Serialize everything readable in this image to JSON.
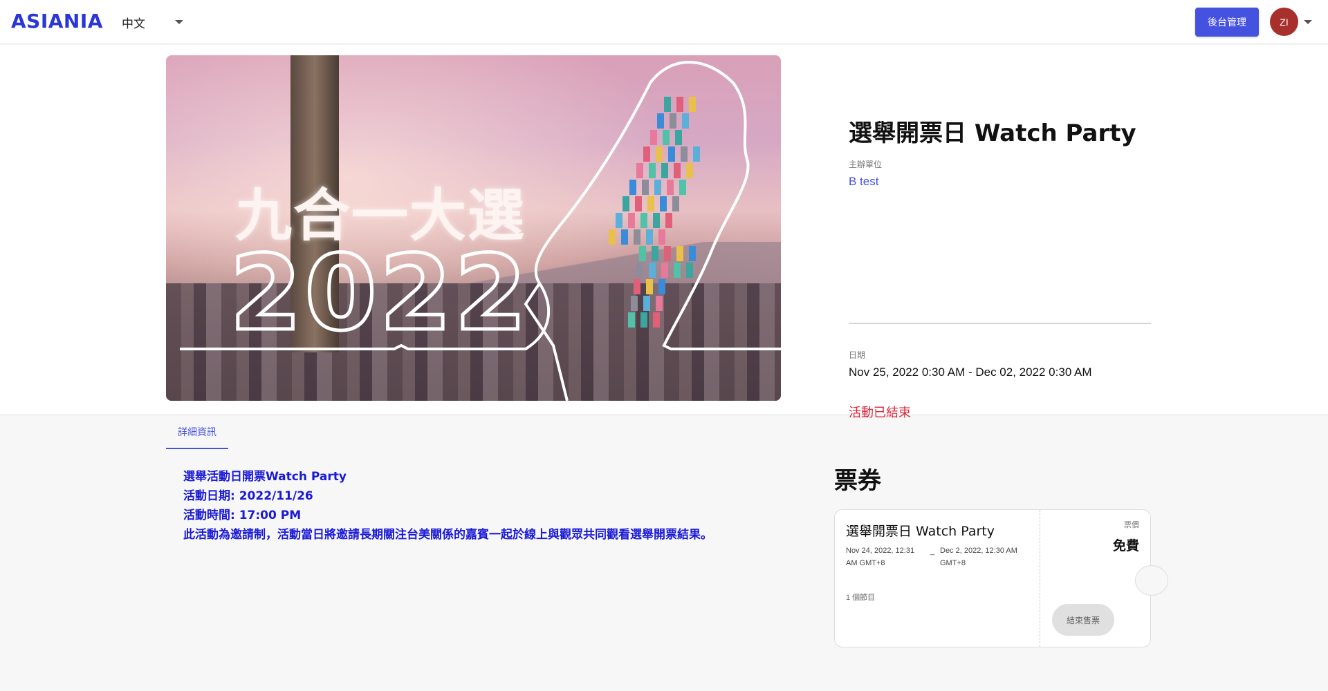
{
  "header": {
    "logo": "ASIANIA",
    "language": "中文",
    "admin_button": "後台管理",
    "avatar_initials": "ZI"
  },
  "banner": {
    "headline": "九合一大選",
    "year": "2022"
  },
  "event": {
    "title": "選舉開票日 Watch Party",
    "organizer_label": "主辦單位",
    "organizer_name": "B test",
    "date_label": "日期",
    "date_value": "Nov 25, 2022 0:30 AM - Dec 02, 2022 0:30 AM",
    "status": "活動已結束"
  },
  "tabs": [
    {
      "label": "詳細資訊",
      "active": true
    }
  ],
  "description": {
    "lines": [
      "選舉活動日開票Watch Party",
      "活動日期: 2022/11/26",
      "活動時間: 17:00 PM",
      "此活動為邀請制，活動當日將邀請長期關注台美關係的嘉賓一起於線上與觀眾共同觀看選舉開票結果。"
    ]
  },
  "tickets": {
    "heading": "票券",
    "items": [
      {
        "name": "選舉開票日 Watch Party",
        "start": "Nov 24, 2022, 12:31 AM GMT+8",
        "separator": "_",
        "end": "Dec 2, 2022, 12:30 AM GMT+8",
        "items_count": "1 個節目",
        "price_label": "票價",
        "price": "免費",
        "action": "結束售票"
      }
    ]
  },
  "colors": {
    "accent": "#4552e0",
    "logo": "#2a36d6",
    "status_ended": "#d9283c",
    "description_text": "#1a1ad6",
    "avatar_bg": "#a8302c"
  }
}
